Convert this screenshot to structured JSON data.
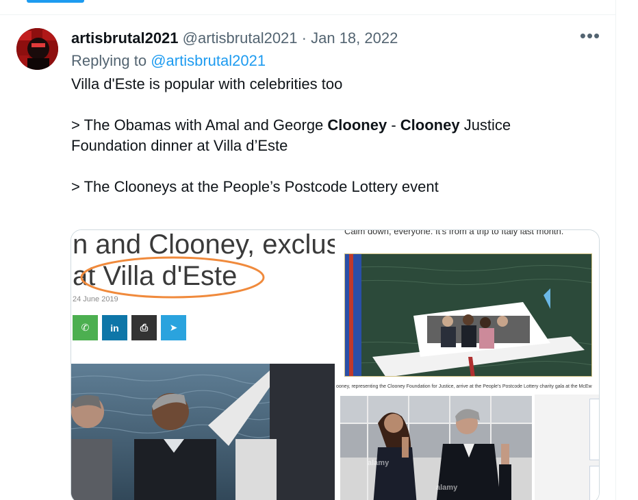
{
  "tweet": {
    "display_name": "artisbrutal2021",
    "handle": "@artisbrutal2021",
    "separator": "·",
    "date": "Jan 18, 2022",
    "more_icon": "more-horizontal-icon",
    "reply_prefix": "Replying to",
    "reply_to": "@artisbrutal2021",
    "line1": "Villa d'Este is popular with celebrities too",
    "line2_pre": "> The Obamas with Amal and George ",
    "line2_bold1": "Clooney",
    "line2_mid": " - ",
    "line2_bold2": "Clooney",
    "line2_post": " Justice",
    "line3": "Foundation dinner at Villa d’Este",
    "line4": "> The Clooneys at the People’s Postcode Lottery event"
  },
  "media": {
    "left": {
      "headline1": "n and Clooney, exclusiv",
      "headline2": "at Villa d'Este",
      "pubdate": "24 June 2019",
      "share_buttons": [
        {
          "name": "whatsapp-icon",
          "glyph": "✆"
        },
        {
          "name": "linkedin-icon",
          "glyph": "in"
        },
        {
          "name": "print-icon",
          "glyph": "⎙"
        },
        {
          "name": "telegram-icon",
          "glyph": "➤"
        }
      ]
    },
    "right_top": {
      "caption": "Calm down, everyone. It's from a trip to Italy last month."
    },
    "right_bottom": {
      "caption": "ooney, representing the Clooney Foundation for Justice, arrive at the People's Postcode Lottery charity gala at the McEw",
      "watermark": "alamy"
    }
  },
  "colors": {
    "accent": "#1d9bf0",
    "annotation_oval": "#f08a3c"
  }
}
